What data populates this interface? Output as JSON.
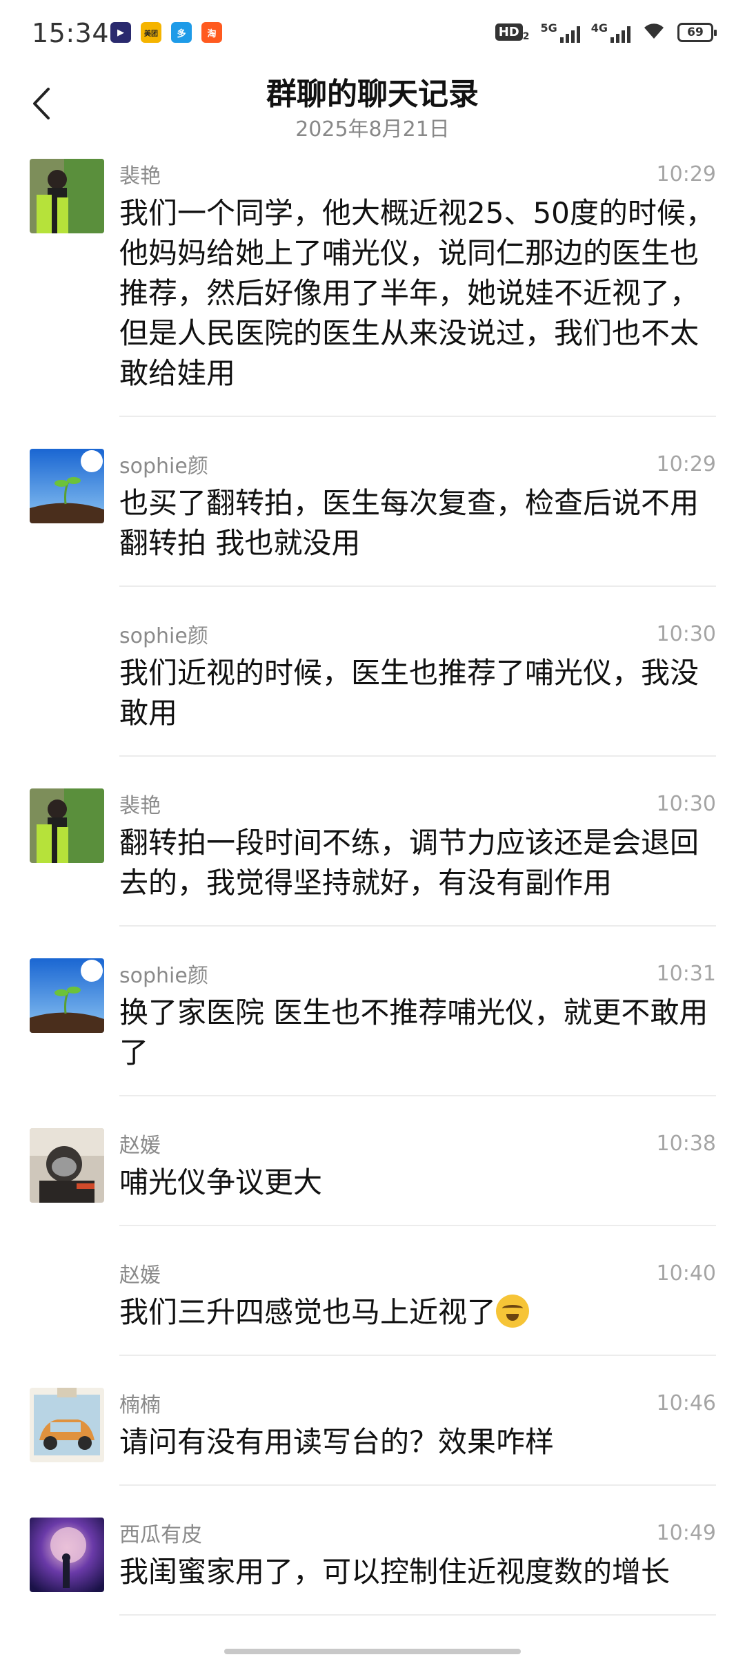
{
  "status_bar": {
    "time": "15:34",
    "notification_icons": [
      {
        "name": "video-app-icon",
        "color": "#2a2a6e",
        "glyph": "▶"
      },
      {
        "name": "meituan-app-icon",
        "color": "#f5b400",
        "glyph": "美团"
      },
      {
        "name": "duoduo-app-icon",
        "color": "#1e9be8",
        "glyph": "多"
      },
      {
        "name": "taobao-app-icon",
        "color": "#ff5a1f",
        "glyph": "淘"
      }
    ],
    "hd_label": "HD",
    "hd_sub": "2",
    "network1": "5G",
    "network2": "4G",
    "battery": "69"
  },
  "header": {
    "title": "群聊的聊天记录",
    "date": "2025年8月21日"
  },
  "messages": [
    {
      "sender": "裴艳",
      "time": "10:29",
      "text": "我们一个同学，他大概近视25、50度的时候，他妈妈给她上了哺光仪，说同仁那边的医生也推荐，然后好像用了半年，她说娃不近视了，但是人民医院的医生从来没说过，我们也不太敢给娃用",
      "avatar": "girl"
    },
    {
      "sender": "sophie颜",
      "time": "10:29",
      "text": "也买了翻转拍，医生每次复查，检查后说不用翻转拍 我也就没用",
      "avatar": "sprout"
    },
    {
      "sender": "sophie颜",
      "time": "10:30",
      "text": "我们近视的时候，医生也推荐了哺光仪，我没敢用",
      "avatar": "none"
    },
    {
      "sender": "裴艳",
      "time": "10:30",
      "text": "翻转拍一段时间不练，调节力应该还是会退回去的，我觉得坚持就好，有没有副作用",
      "avatar": "girl"
    },
    {
      "sender": "sophie颜",
      "time": "10:31",
      "text": "换了家医院 医生也不推荐哺光仪，就更不敢用了",
      "avatar": "sprout"
    },
    {
      "sender": "赵媛",
      "time": "10:38",
      "text": "哺光仪争议更大",
      "avatar": "person"
    },
    {
      "sender": "赵媛",
      "time": "10:40",
      "text": "我们三升四感觉也马上近视了",
      "avatar": "none",
      "emoji": "crying-laughing-emoji"
    },
    {
      "sender": "楠楠",
      "time": "10:46",
      "text": "请问有没有用读写台的？效果咋样",
      "avatar": "car"
    },
    {
      "sender": "西瓜有皮",
      "time": "10:49",
      "text": "我闺蜜家用了，可以控制住近视度数的增长",
      "avatar": "galaxy"
    }
  ]
}
